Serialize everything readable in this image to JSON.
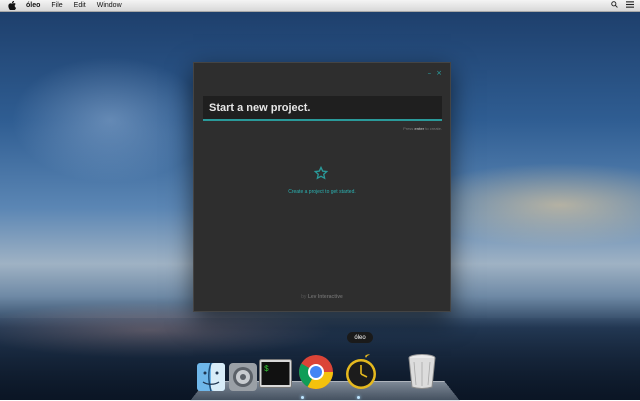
{
  "menubar": {
    "app_name": "óleo",
    "items": [
      "File",
      "Edit",
      "Window"
    ]
  },
  "window": {
    "controls": {
      "minimize": "–",
      "close": "×"
    },
    "input_placeholder": "Start a new project.",
    "hint_prefix": "Press ",
    "hint_key": "enter",
    "hint_suffix": " to create.",
    "empty_message": "Create a project to get started.",
    "credit_prefix": "by ",
    "credit_name": "Lev Interactive"
  },
  "dock": {
    "tooltip": "óleo",
    "icons": [
      "finder-icon",
      "system-preferences-icon",
      "terminal-icon",
      "chrome-icon",
      "oleo-icon",
      "trash-icon"
    ]
  },
  "colors": {
    "accent": "#2a9a9a",
    "window_bg": "#2e2e2e",
    "input_bg": "#1f1f1f"
  }
}
